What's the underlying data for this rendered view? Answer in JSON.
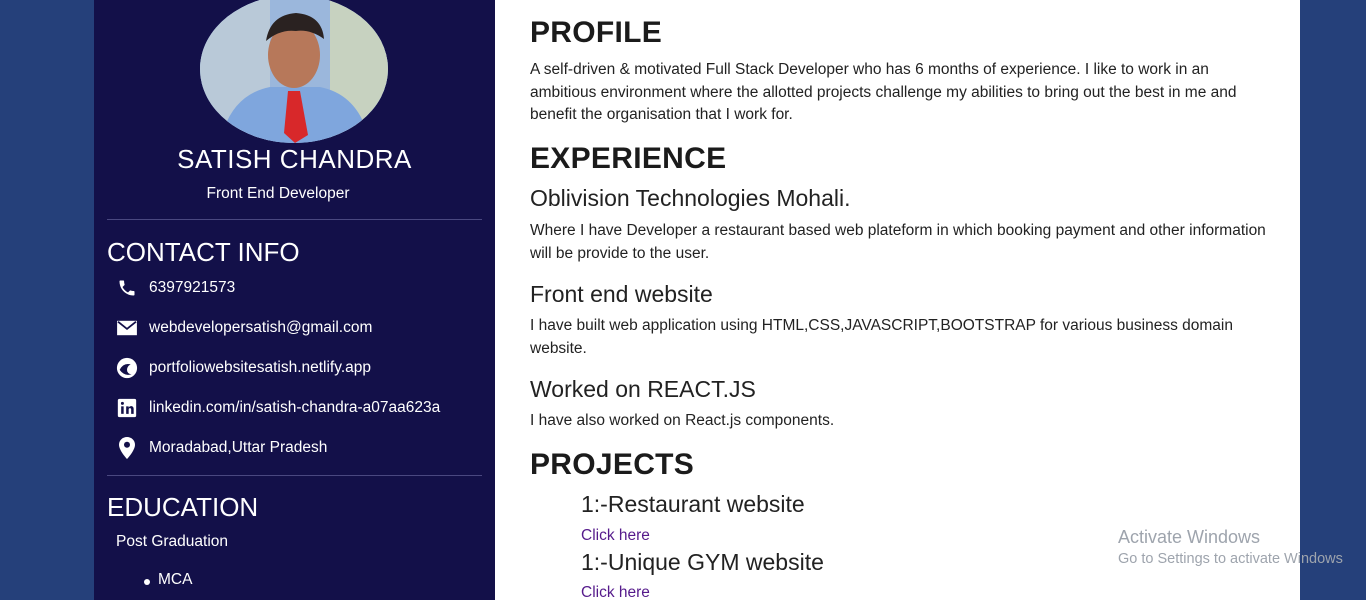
{
  "profile_card": {
    "name": "SATISH CHANDRA",
    "role": "Front End Developer"
  },
  "contact": {
    "heading": "CONTACT INFO",
    "items": [
      {
        "icon": "phone-icon",
        "text": "6397921573"
      },
      {
        "icon": "mail-icon",
        "text": "webdevelopersatish@gmail.com"
      },
      {
        "icon": "globe-icon",
        "text": "portfoliowebsitesatish.netlify.app"
      },
      {
        "icon": "linkedin-icon",
        "text": "linkedin.com/in/satish-chandra-a07aa623a"
      },
      {
        "icon": "location-pin-icon",
        "text": "Moradabad,Uttar Pradesh"
      }
    ]
  },
  "education": {
    "heading": "EDUCATION",
    "level": "Post Graduation",
    "items": [
      "MCA"
    ]
  },
  "profile": {
    "heading": "PROFILE",
    "text": "A self-driven & motivated Full Stack Developer who has 6 months of experience. I like to work in an ambitious environment where the allotted projects challenge my abilities to bring out the best in me and benefit the organisation that I work for."
  },
  "experience": {
    "heading": "EXPERIENCE",
    "items": [
      {
        "title": "Oblivision Technologies Mohali.",
        "text": "Where I have Developer a restaurant based web plateform in which booking payment and other information will be provide to the user."
      },
      {
        "title": "Front end website",
        "text": "I have built web application using HTML,CSS,JAVASCRIPT,BOOTSTRAP for various business domain website."
      },
      {
        "title": "Worked on REACT.JS",
        "text": "I have also worked on React.js components."
      }
    ]
  },
  "projects": {
    "heading": "PROJECTS",
    "items": [
      {
        "title": "1:-Restaurant website",
        "link": "Click here"
      },
      {
        "title": "1:-Unique GYM website",
        "link": "Click here"
      }
    ]
  },
  "watermark": {
    "line1": "Activate Windows",
    "line2": "Go to Settings to activate Windows"
  },
  "colors": {
    "page_background": "#25407a",
    "sidebar_background": "#131049",
    "link": "#551a8b"
  }
}
